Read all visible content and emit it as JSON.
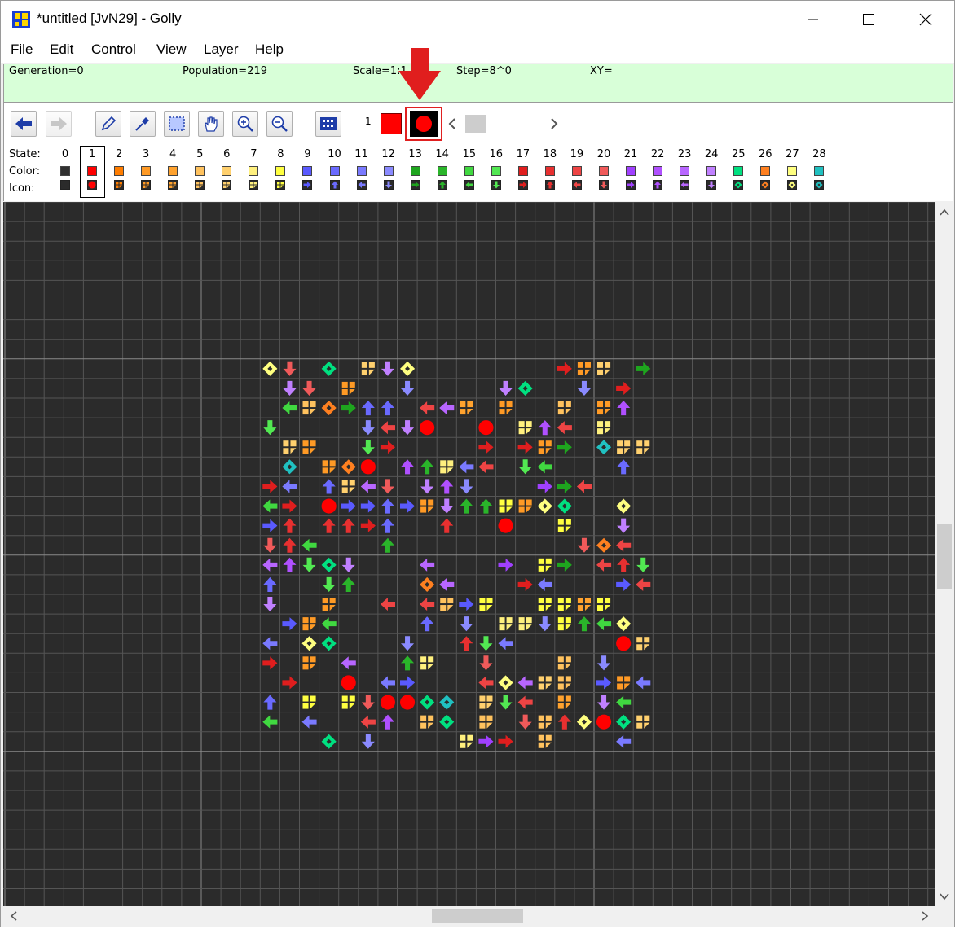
{
  "window": {
    "title": "*untitled [JvN29] - Golly",
    "controls": [
      "minimize",
      "maximize",
      "close"
    ]
  },
  "menu": [
    "File",
    "Edit",
    "Control",
    "View",
    "Layer",
    "Help"
  ],
  "status": {
    "generation": "Generation=0",
    "population": "Population=219",
    "scale": "Scale=1:1",
    "step": "Step=8^0",
    "xy": "XY="
  },
  "toolbar": {
    "current_state": "1",
    "tools": [
      "start-icon",
      "step-icon",
      "draw-icon",
      "pick-icon",
      "select-icon",
      "move-icon",
      "zoom-in-icon",
      "zoom-out-icon",
      "grid-icon"
    ]
  },
  "palette": {
    "state_label": "State:",
    "color_label": "Color:",
    "icon_label": "Icon:",
    "selected_state": 1,
    "states": [
      {
        "n": "0",
        "color": "#303030",
        "icon": "empty"
      },
      {
        "n": "1",
        "color": "#ff0000",
        "icon": "circle"
      },
      {
        "n": "2",
        "color": "#ff7d00",
        "icon": "quad"
      },
      {
        "n": "3",
        "color": "#ff9a25",
        "icon": "quad"
      },
      {
        "n": "4",
        "color": "#ffa22e",
        "icon": "quad"
      },
      {
        "n": "5",
        "color": "#ffc25e",
        "icon": "quad"
      },
      {
        "n": "6",
        "color": "#ffd06e",
        "icon": "quad"
      },
      {
        "n": "7",
        "color": "#fff07e",
        "icon": "quad"
      },
      {
        "n": "8",
        "color": "#ffff40",
        "icon": "quad"
      },
      {
        "n": "9",
        "color": "#5a5aff",
        "icon": "right"
      },
      {
        "n": "10",
        "color": "#6a6aff",
        "icon": "up"
      },
      {
        "n": "11",
        "color": "#7a7aff",
        "icon": "left"
      },
      {
        "n": "12",
        "color": "#8a8aff",
        "icon": "down"
      },
      {
        "n": "13",
        "color": "#1ea51e",
        "icon": "right"
      },
      {
        "n": "14",
        "color": "#2ab52a",
        "icon": "up"
      },
      {
        "n": "15",
        "color": "#40d840",
        "icon": "left"
      },
      {
        "n": "16",
        "color": "#52e852",
        "icon": "down"
      },
      {
        "n": "17",
        "color": "#e01e1e",
        "icon": "right"
      },
      {
        "n": "18",
        "color": "#e83030",
        "icon": "up"
      },
      {
        "n": "19",
        "color": "#ee4444",
        "icon": "left"
      },
      {
        "n": "20",
        "color": "#f05a5a",
        "icon": "down"
      },
      {
        "n": "21",
        "color": "#a040ff",
        "icon": "right"
      },
      {
        "n": "22",
        "color": "#b050ff",
        "icon": "up"
      },
      {
        "n": "23",
        "color": "#b866ff",
        "icon": "left"
      },
      {
        "n": "24",
        "color": "#c080ff",
        "icon": "down"
      },
      {
        "n": "25",
        "color": "#00e080",
        "icon": "diamond"
      },
      {
        "n": "26",
        "color": "#ff8020",
        "icon": "diamond"
      },
      {
        "n": "27",
        "color": "#ffff80",
        "icon": "diamond"
      },
      {
        "n": "28",
        "color": "#20c0c0",
        "icon": "diamond"
      }
    ]
  },
  "pattern": {
    "cell_origin_col": 0,
    "cells": [
      [
        0,
        0,
        27
      ],
      [
        1,
        0,
        20
      ],
      [
        3,
        0,
        25
      ],
      [
        5,
        0,
        6
      ],
      [
        6,
        0,
        24
      ],
      [
        7,
        0,
        27
      ],
      [
        15,
        0,
        17
      ],
      [
        16,
        0,
        3
      ],
      [
        17,
        0,
        6
      ],
      [
        19,
        0,
        13
      ],
      [
        1,
        1,
        24
      ],
      [
        2,
        1,
        20
      ],
      [
        4,
        1,
        3
      ],
      [
        7,
        1,
        12
      ],
      [
        12,
        1,
        24
      ],
      [
        13,
        1,
        25
      ],
      [
        16,
        1,
        12
      ],
      [
        18,
        1,
        17
      ],
      [
        1,
        2,
        15
      ],
      [
        2,
        2,
        5
      ],
      [
        3,
        2,
        26
      ],
      [
        4,
        2,
        13
      ],
      [
        5,
        2,
        10
      ],
      [
        6,
        2,
        10
      ],
      [
        8,
        2,
        19
      ],
      [
        9,
        2,
        23
      ],
      [
        10,
        2,
        4
      ],
      [
        12,
        2,
        3
      ],
      [
        15,
        2,
        5
      ],
      [
        17,
        2,
        3
      ],
      [
        18,
        2,
        22
      ],
      [
        0,
        3,
        16
      ],
      [
        5,
        3,
        12
      ],
      [
        6,
        3,
        19
      ],
      [
        7,
        3,
        24
      ],
      [
        8,
        3,
        1
      ],
      [
        11,
        3,
        1
      ],
      [
        13,
        3,
        7
      ],
      [
        14,
        3,
        22
      ],
      [
        15,
        3,
        19
      ],
      [
        17,
        3,
        7
      ],
      [
        1,
        4,
        6
      ],
      [
        2,
        4,
        3
      ],
      [
        5,
        4,
        16
      ],
      [
        6,
        4,
        17
      ],
      [
        11,
        4,
        17
      ],
      [
        13,
        4,
        17
      ],
      [
        14,
        4,
        3
      ],
      [
        15,
        4,
        13
      ],
      [
        17,
        4,
        28
      ],
      [
        18,
        4,
        6
      ],
      [
        19,
        4,
        6
      ],
      [
        1,
        5,
        28
      ],
      [
        3,
        5,
        3
      ],
      [
        4,
        5,
        26
      ],
      [
        5,
        5,
        1
      ],
      [
        7,
        5,
        22
      ],
      [
        8,
        5,
        14
      ],
      [
        9,
        5,
        7
      ],
      [
        10,
        5,
        11
      ],
      [
        11,
        5,
        19
      ],
      [
        13,
        5,
        16
      ],
      [
        14,
        5,
        15
      ],
      [
        18,
        5,
        10
      ],
      [
        0,
        6,
        17
      ],
      [
        1,
        6,
        11
      ],
      [
        3,
        6,
        10
      ],
      [
        4,
        6,
        6
      ],
      [
        5,
        6,
        23
      ],
      [
        6,
        6,
        20
      ],
      [
        8,
        6,
        24
      ],
      [
        9,
        6,
        22
      ],
      [
        10,
        6,
        12
      ],
      [
        14,
        6,
        21
      ],
      [
        15,
        6,
        13
      ],
      [
        16,
        6,
        19
      ],
      [
        0,
        7,
        15
      ],
      [
        1,
        7,
        17
      ],
      [
        3,
        7,
        1
      ],
      [
        4,
        7,
        9
      ],
      [
        5,
        7,
        9
      ],
      [
        6,
        7,
        10
      ],
      [
        7,
        7,
        9
      ],
      [
        8,
        7,
        3
      ],
      [
        9,
        7,
        24
      ],
      [
        10,
        7,
        14
      ],
      [
        11,
        7,
        14
      ],
      [
        12,
        7,
        8
      ],
      [
        13,
        7,
        3
      ],
      [
        14,
        7,
        27
      ],
      [
        15,
        7,
        25
      ],
      [
        18,
        7,
        27
      ],
      [
        0,
        8,
        9
      ],
      [
        1,
        8,
        18
      ],
      [
        3,
        8,
        18
      ],
      [
        4,
        8,
        18
      ],
      [
        5,
        8,
        17
      ],
      [
        6,
        8,
        10
      ],
      [
        9,
        8,
        18
      ],
      [
        12,
        8,
        1
      ],
      [
        15,
        8,
        8
      ],
      [
        18,
        8,
        24
      ],
      [
        0,
        9,
        20
      ],
      [
        1,
        9,
        18
      ],
      [
        2,
        9,
        15
      ],
      [
        6,
        9,
        14
      ],
      [
        16,
        9,
        20
      ],
      [
        17,
        9,
        26
      ],
      [
        18,
        9,
        19
      ],
      [
        0,
        10,
        23
      ],
      [
        1,
        10,
        22
      ],
      [
        2,
        10,
        16
      ],
      [
        3,
        10,
        25
      ],
      [
        4,
        10,
        24
      ],
      [
        8,
        10,
        23
      ],
      [
        12,
        10,
        21
      ],
      [
        14,
        10,
        8
      ],
      [
        15,
        10,
        13
      ],
      [
        17,
        10,
        19
      ],
      [
        18,
        10,
        18
      ],
      [
        19,
        10,
        16
      ],
      [
        0,
        11,
        10
      ],
      [
        3,
        11,
        16
      ],
      [
        4,
        11,
        14
      ],
      [
        8,
        11,
        26
      ],
      [
        9,
        11,
        23
      ],
      [
        13,
        11,
        17
      ],
      [
        14,
        11,
        11
      ],
      [
        18,
        11,
        9
      ],
      [
        19,
        11,
        19
      ],
      [
        0,
        12,
        24
      ],
      [
        3,
        12,
        3
      ],
      [
        6,
        12,
        19
      ],
      [
        8,
        12,
        19
      ],
      [
        9,
        12,
        5
      ],
      [
        10,
        12,
        9
      ],
      [
        11,
        12,
        8
      ],
      [
        14,
        12,
        8
      ],
      [
        15,
        12,
        8
      ],
      [
        16,
        12,
        4
      ],
      [
        17,
        12,
        8
      ],
      [
        1,
        13,
        9
      ],
      [
        2,
        13,
        3
      ],
      [
        3,
        13,
        15
      ],
      [
        8,
        13,
        10
      ],
      [
        10,
        13,
        12
      ],
      [
        12,
        13,
        7
      ],
      [
        13,
        13,
        7
      ],
      [
        14,
        13,
        12
      ],
      [
        15,
        13,
        8
      ],
      [
        16,
        13,
        14
      ],
      [
        17,
        13,
        15
      ],
      [
        18,
        13,
        27
      ],
      [
        0,
        14,
        11
      ],
      [
        2,
        14,
        27
      ],
      [
        3,
        14,
        25
      ],
      [
        7,
        14,
        12
      ],
      [
        10,
        14,
        18
      ],
      [
        11,
        14,
        16
      ],
      [
        12,
        14,
        11
      ],
      [
        18,
        14,
        1
      ],
      [
        19,
        14,
        6
      ],
      [
        0,
        15,
        17
      ],
      [
        2,
        15,
        3
      ],
      [
        4,
        15,
        23
      ],
      [
        7,
        15,
        14
      ],
      [
        8,
        15,
        7
      ],
      [
        11,
        15,
        20
      ],
      [
        15,
        15,
        5
      ],
      [
        17,
        15,
        12
      ],
      [
        1,
        16,
        17
      ],
      [
        4,
        16,
        1
      ],
      [
        6,
        16,
        11
      ],
      [
        7,
        16,
        9
      ],
      [
        11,
        16,
        19
      ],
      [
        12,
        16,
        27
      ],
      [
        13,
        16,
        23
      ],
      [
        14,
        16,
        6
      ],
      [
        15,
        16,
        5
      ],
      [
        17,
        16,
        9
      ],
      [
        18,
        16,
        3
      ],
      [
        19,
        16,
        11
      ],
      [
        0,
        17,
        10
      ],
      [
        2,
        17,
        8
      ],
      [
        4,
        17,
        8
      ],
      [
        5,
        17,
        20
      ],
      [
        6,
        17,
        1
      ],
      [
        7,
        17,
        1
      ],
      [
        8,
        17,
        25
      ],
      [
        9,
        17,
        28
      ],
      [
        11,
        17,
        6
      ],
      [
        12,
        17,
        16
      ],
      [
        13,
        17,
        19
      ],
      [
        15,
        17,
        4
      ],
      [
        17,
        17,
        24
      ],
      [
        18,
        17,
        15
      ],
      [
        0,
        18,
        15
      ],
      [
        2,
        18,
        11
      ],
      [
        5,
        18,
        19
      ],
      [
        6,
        18,
        22
      ],
      [
        8,
        18,
        5
      ],
      [
        9,
        18,
        25
      ],
      [
        11,
        18,
        5
      ],
      [
        13,
        18,
        20
      ],
      [
        14,
        18,
        5
      ],
      [
        15,
        18,
        18
      ],
      [
        16,
        18,
        27
      ],
      [
        17,
        18,
        1
      ],
      [
        18,
        18,
        25
      ],
      [
        19,
        18,
        6
      ],
      [
        3,
        19,
        25
      ],
      [
        5,
        19,
        12
      ],
      [
        10,
        19,
        7
      ],
      [
        11,
        19,
        21
      ],
      [
        12,
        19,
        17
      ],
      [
        14,
        19,
        5
      ],
      [
        18,
        19,
        11
      ]
    ]
  }
}
